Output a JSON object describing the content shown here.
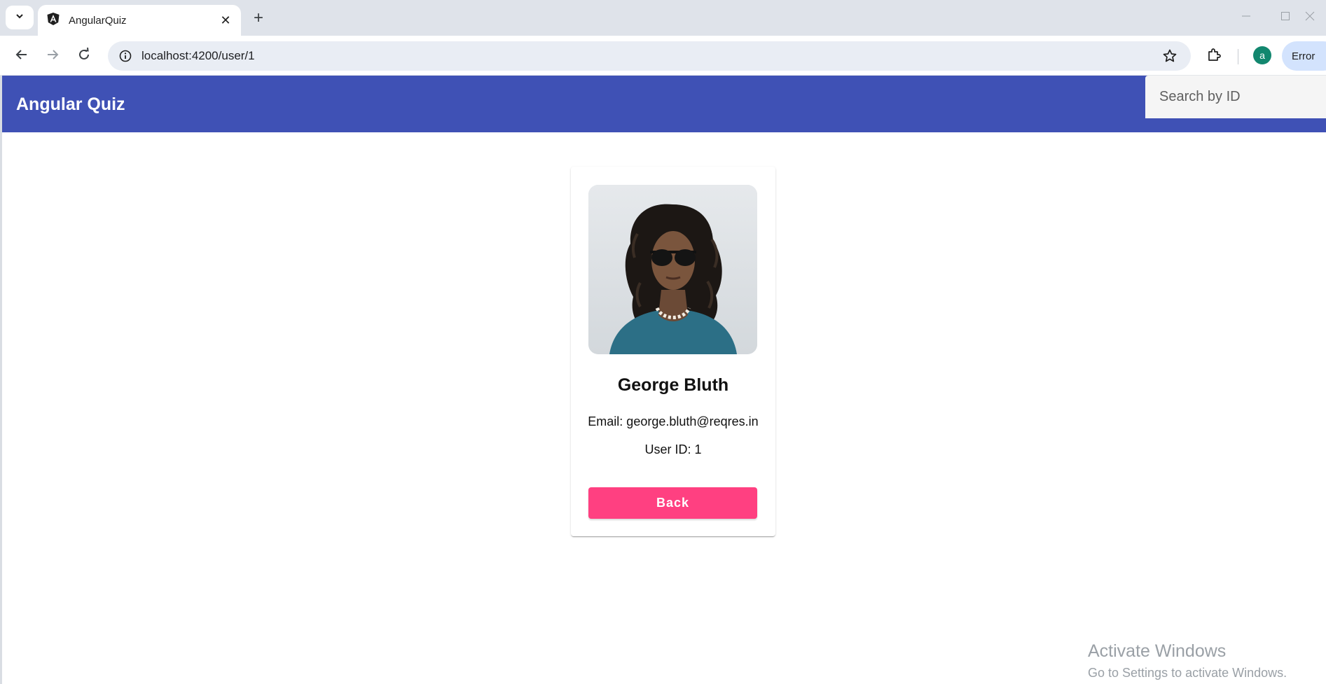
{
  "browser": {
    "tab_title": "AngularQuiz",
    "url": "localhost:4200/user/1",
    "profile_initial": "a",
    "error_label": "Error"
  },
  "app": {
    "title": "Angular Quiz",
    "search_placeholder": "Search by ID"
  },
  "user": {
    "name": "George Bluth",
    "email_text": "Email: george.bluth@reqres.in",
    "id_text": "User ID: 1",
    "back_label": "Back"
  },
  "watermark": {
    "title": "Activate Windows",
    "subtitle": "Go to Settings to activate Windows."
  },
  "colors": {
    "app_bar": "#3f51b5",
    "accent_button": "#ff4081",
    "profile_avatar": "#12876f"
  }
}
